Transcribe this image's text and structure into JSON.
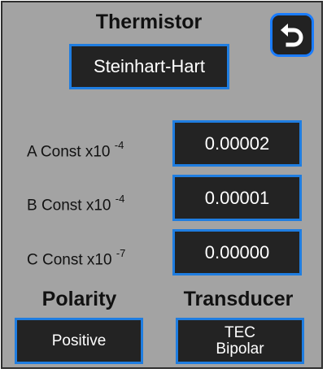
{
  "title": "Thermistor",
  "method": "Steinhart-Hart",
  "constants": [
    {
      "label": "A Const x10",
      "exponent": "-4",
      "value": "0.00002"
    },
    {
      "label": "B Const x10",
      "exponent": "-4",
      "value": "0.00001"
    },
    {
      "label": "C Const x10",
      "exponent": "-7",
      "value": "0.00000"
    }
  ],
  "polarity": {
    "heading": "Polarity",
    "value": "Positive"
  },
  "transducer": {
    "heading": "Transducer",
    "line1": "TEC",
    "line2": "Bipolar"
  },
  "colors": {
    "panel": "#a3a3a3",
    "box": "#232323",
    "accent": "#1f7de0"
  },
  "icons": {
    "back": "return-arrow-icon"
  }
}
